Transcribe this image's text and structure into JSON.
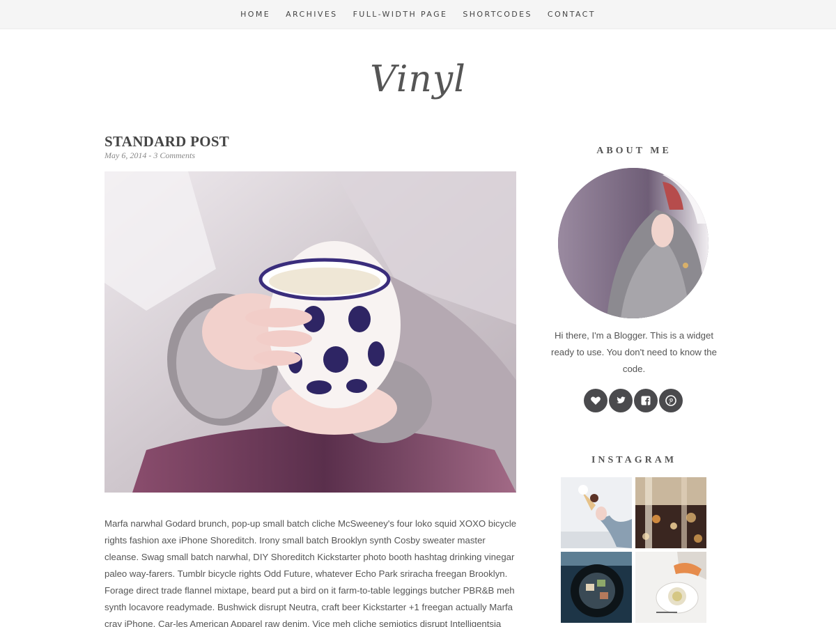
{
  "nav": {
    "items": [
      {
        "label": "HOME"
      },
      {
        "label": "ARCHIVES"
      },
      {
        "label": "FULL-WIDTH PAGE"
      },
      {
        "label": "SHORTCODES"
      },
      {
        "label": "CONTACT"
      }
    ]
  },
  "site": {
    "logo": "Vinyl"
  },
  "post": {
    "title": "STANDARD POST",
    "date": "May 6, 2014",
    "separator": " - ",
    "comments": "3 Comments",
    "image_desc": "featured-image",
    "body": "Marfa narwhal Godard brunch, pop-up small batch cliche McSweeney's four loko squid XOXO bicycle rights fashion axe iPhone Shoreditch. Irony small batch Brooklyn synth Cosby sweater master cleanse. Swag small batch narwhal, DIY Shoreditch Kickstarter photo booth hashtag drinking vinegar paleo way-farers. Tumblr bicycle rights Odd Future, whatever Echo Park sriracha freegan Brooklyn. Forage direct trade flannel mixtape, beard put a bird on it farm-to-table leggings butcher PBR&B meh synth locavore readymade. Bushwick disrupt Neutra, craft beer Kickstarter +1 freegan actually Marfa cray iPhone. Car-les American Apparel raw denim, Vice meh cliche semiotics disrupt Intelligentsia occupy actually mix-"
  },
  "sidebar": {
    "about": {
      "title": "ABOUT ME",
      "text": "Hi there, I'm a Blogger. This is a widget ready to use. You don't need to know the code."
    },
    "socials": [
      {
        "icon": "heart-icon"
      },
      {
        "icon": "twitter-icon"
      },
      {
        "icon": "facebook-icon"
      },
      {
        "icon": "pinterest-icon"
      }
    ],
    "instagram": {
      "title": "INSTAGRAM"
    }
  },
  "colors": {
    "nav_bg": "#f5f5f5",
    "text": "#444444",
    "social_bg": "#4a4a4d"
  }
}
